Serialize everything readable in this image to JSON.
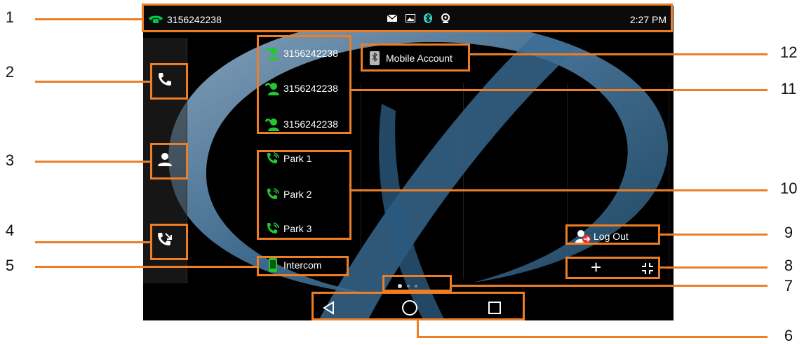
{
  "status_bar": {
    "line_number": "3156242238",
    "time": "2:27 PM",
    "icons": [
      "envelope-icon",
      "image-icon",
      "bluetooth-icon",
      "webcam-icon"
    ]
  },
  "sidebar": {
    "buttons": [
      "phone-icon",
      "contacts-icon",
      "call-forward-icon"
    ]
  },
  "line_keys": [
    {
      "label": "3156242238",
      "icon": "registered-line-icon"
    },
    {
      "label": "3156242238",
      "icon": "registered-line-icon"
    },
    {
      "label": "3156242238",
      "icon": "registered-line-icon"
    }
  ],
  "park_keys": [
    {
      "label": "Park 1",
      "icon": "park-call-icon"
    },
    {
      "label": "Park 2",
      "icon": "park-call-icon"
    },
    {
      "label": "Park 3",
      "icon": "park-call-icon"
    }
  ],
  "intercom": {
    "label": "Intercom",
    "icon": "intercom-icon"
  },
  "mobile_account": {
    "label": "Mobile Account",
    "icon": "bluetooth-mobile-icon"
  },
  "logout": {
    "label": "Log Out",
    "icon": "logout-icon"
  },
  "add_label": "+",
  "pages": {
    "count": 3,
    "current": 1
  },
  "navbar": [
    "back-icon",
    "home-icon",
    "recents-icon"
  ],
  "callout_numbers": [
    "1",
    "2",
    "3",
    "4",
    "5",
    "6",
    "7",
    "8",
    "9",
    "10",
    "11",
    "12"
  ],
  "colors": {
    "accent": "#ee7d23",
    "line_icon_green": "#22c832",
    "status_green": "#00c44a",
    "bluetooth": "#3ad6c4"
  }
}
